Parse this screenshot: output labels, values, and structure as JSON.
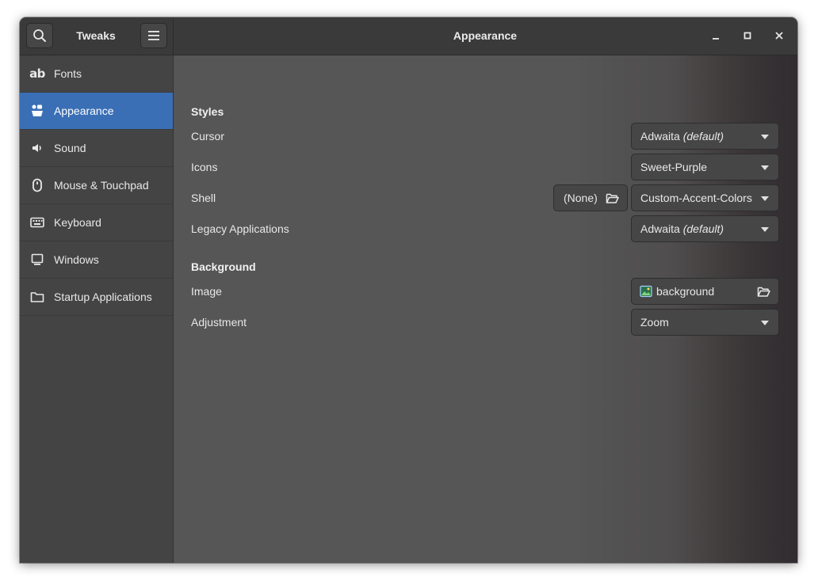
{
  "app_title": "Tweaks",
  "page_title": "Appearance",
  "sidebar": {
    "items": [
      {
        "label": "Fonts",
        "icon": "font-ab-icon"
      },
      {
        "label": "Appearance",
        "icon": "appearance-icon",
        "active": true
      },
      {
        "label": "Sound",
        "icon": "speaker-icon"
      },
      {
        "label": "Mouse & Touchpad",
        "icon": "mouse-icon"
      },
      {
        "label": "Keyboard",
        "icon": "keyboard-icon"
      },
      {
        "label": "Windows",
        "icon": "monitor-icon"
      },
      {
        "label": "Startup Applications",
        "icon": "folder-icon"
      }
    ]
  },
  "styles": {
    "title": "Styles",
    "cursor": {
      "label": "Cursor",
      "value": "Adwaita",
      "suffix": "(default)"
    },
    "icons": {
      "label": "Icons",
      "value": "Sweet-Purple"
    },
    "shell": {
      "label": "Shell",
      "file_value": "(None)",
      "value": "Custom-Accent-Colors"
    },
    "legacy": {
      "label": "Legacy Applications",
      "value": "Adwaita",
      "suffix": "(default)"
    }
  },
  "background": {
    "title": "Background",
    "image": {
      "label": "Image",
      "value": "background"
    },
    "adjustment": {
      "label": "Adjustment",
      "value": "Zoom"
    }
  },
  "colors": {
    "accent": "#3a6fb5",
    "headerbar": "#3a3a3a",
    "sidebar": "#444444",
    "content": "#565656"
  }
}
